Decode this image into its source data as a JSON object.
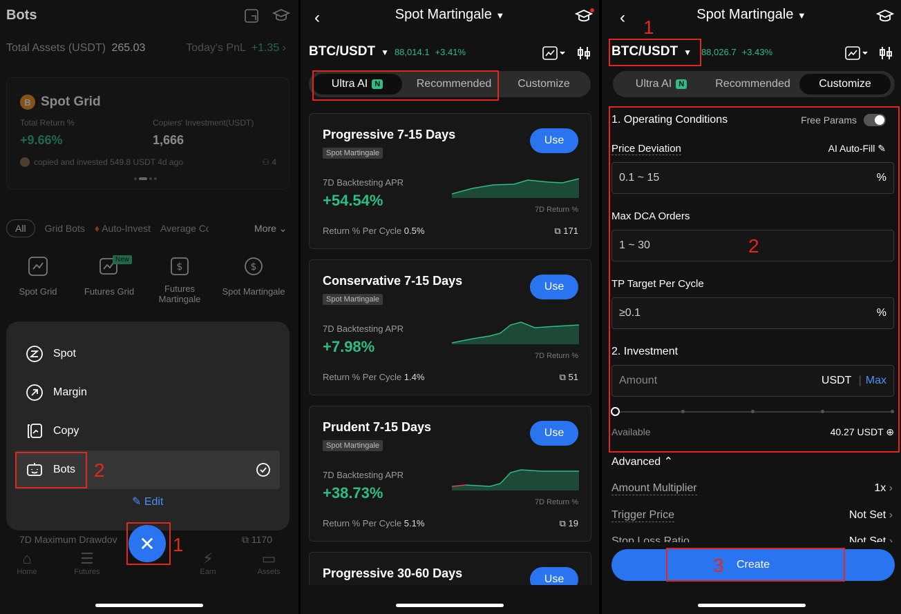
{
  "panel1": {
    "title": "Bots",
    "total_assets_label": "Total Assets (USDT)",
    "total_assets_value": "265.03",
    "pnl_label": "Today's PnL",
    "pnl_value": "+1.35",
    "card": {
      "name": "Spot Grid",
      "ret_label": "Total Return %",
      "ret_value": "+9.66%",
      "inv_label": "Copiers' Investment(USDT)",
      "inv_value": "1,666",
      "copied_text": "copied and invested 549.8 USDT 4d ago",
      "copiers": "4"
    },
    "filters": [
      "All",
      "Grid Bots",
      "Auto-Invest",
      "Average Co",
      "More"
    ],
    "bot_types": [
      {
        "label": "Spot Grid",
        "icon": "spot-grid-icon"
      },
      {
        "label": "Futures Grid",
        "icon": "futures-grid-icon",
        "badge": "New"
      },
      {
        "label": "Futures Martingale",
        "icon": "futures-martingale-icon"
      },
      {
        "label": "Spot Martingale",
        "icon": "spot-martingale-icon"
      }
    ],
    "menu": [
      "Spot",
      "Margin",
      "Copy",
      "Bots"
    ],
    "edit_label": "Edit",
    "behind_label": "7D Maximum Drawdov",
    "behind_count": "1170",
    "tabs": [
      "Home",
      "Futures",
      "Earn",
      "Assets"
    ],
    "annotations": [
      "1",
      "2"
    ]
  },
  "panel2": {
    "title": "Spot Martingale",
    "pair": "BTC/USDT",
    "price": "88,014.1",
    "change": "+3.41%",
    "seg": [
      "Ultra AI",
      "Recommended",
      "Customize"
    ],
    "badge": "N",
    "strategies": [
      {
        "title": "Progressive 7-15 Days",
        "tag": "Spot Martingale",
        "use": "Use",
        "apr_label": "7D Backtesting APR",
        "apr": "+54.54%",
        "ret_label": "Return % Per Cycle",
        "ret": "0.5%",
        "ret7d": "7D Return %",
        "count": "171"
      },
      {
        "title": "Conservative 7-15 Days",
        "tag": "Spot Martingale",
        "use": "Use",
        "apr_label": "7D Backtesting APR",
        "apr": "+7.98%",
        "ret_label": "Return % Per Cycle",
        "ret": "1.4%",
        "ret7d": "7D Return %",
        "count": "51"
      },
      {
        "title": "Prudent 7-15 Days",
        "tag": "Spot Martingale",
        "use": "Use",
        "apr_label": "7D Backtesting APR",
        "apr": "+38.73%",
        "ret_label": "Return % Per Cycle",
        "ret": "5.1%",
        "ret7d": "7D Return %",
        "count": "19"
      },
      {
        "title": "Progressive 30-60 Days",
        "use": "Use"
      }
    ]
  },
  "panel3": {
    "title": "Spot Martingale",
    "pair": "BTC/USDT",
    "price": "88,026.7",
    "change": "+3.43%",
    "seg": [
      "Ultra AI",
      "Recommended",
      "Customize"
    ],
    "badge": "N",
    "section1": "1. Operating Conditions",
    "free_params": "Free Params",
    "price_dev_label": "Price Deviation",
    "ai_fill": "AI Auto-Fill",
    "price_dev_value": "0.1 ~ 15",
    "pct": "%",
    "max_dca_label": "Max DCA Orders",
    "max_dca_value": "1 ~ 30",
    "tp_label": "TP Target Per Cycle",
    "tp_value": "≥0.1",
    "section2": "2. Investment",
    "amount_ph": "Amount",
    "usdt": "USDT",
    "max": "Max",
    "available_label": "Available",
    "available_value": "40.27 USDT",
    "advanced": "Advanced",
    "amount_mult_label": "Amount Multiplier",
    "amount_mult_value": "1x",
    "trigger_label": "Trigger Price",
    "trigger_value": "Not Set",
    "stop_label": "Stop Loss Ratio",
    "stop_value": "Not Set",
    "create": "Create",
    "annotations": [
      "1",
      "2",
      "3"
    ]
  },
  "colors": {
    "green": "#2ebd85",
    "blue": "#2b74f0",
    "annotation": "#e0281f"
  }
}
